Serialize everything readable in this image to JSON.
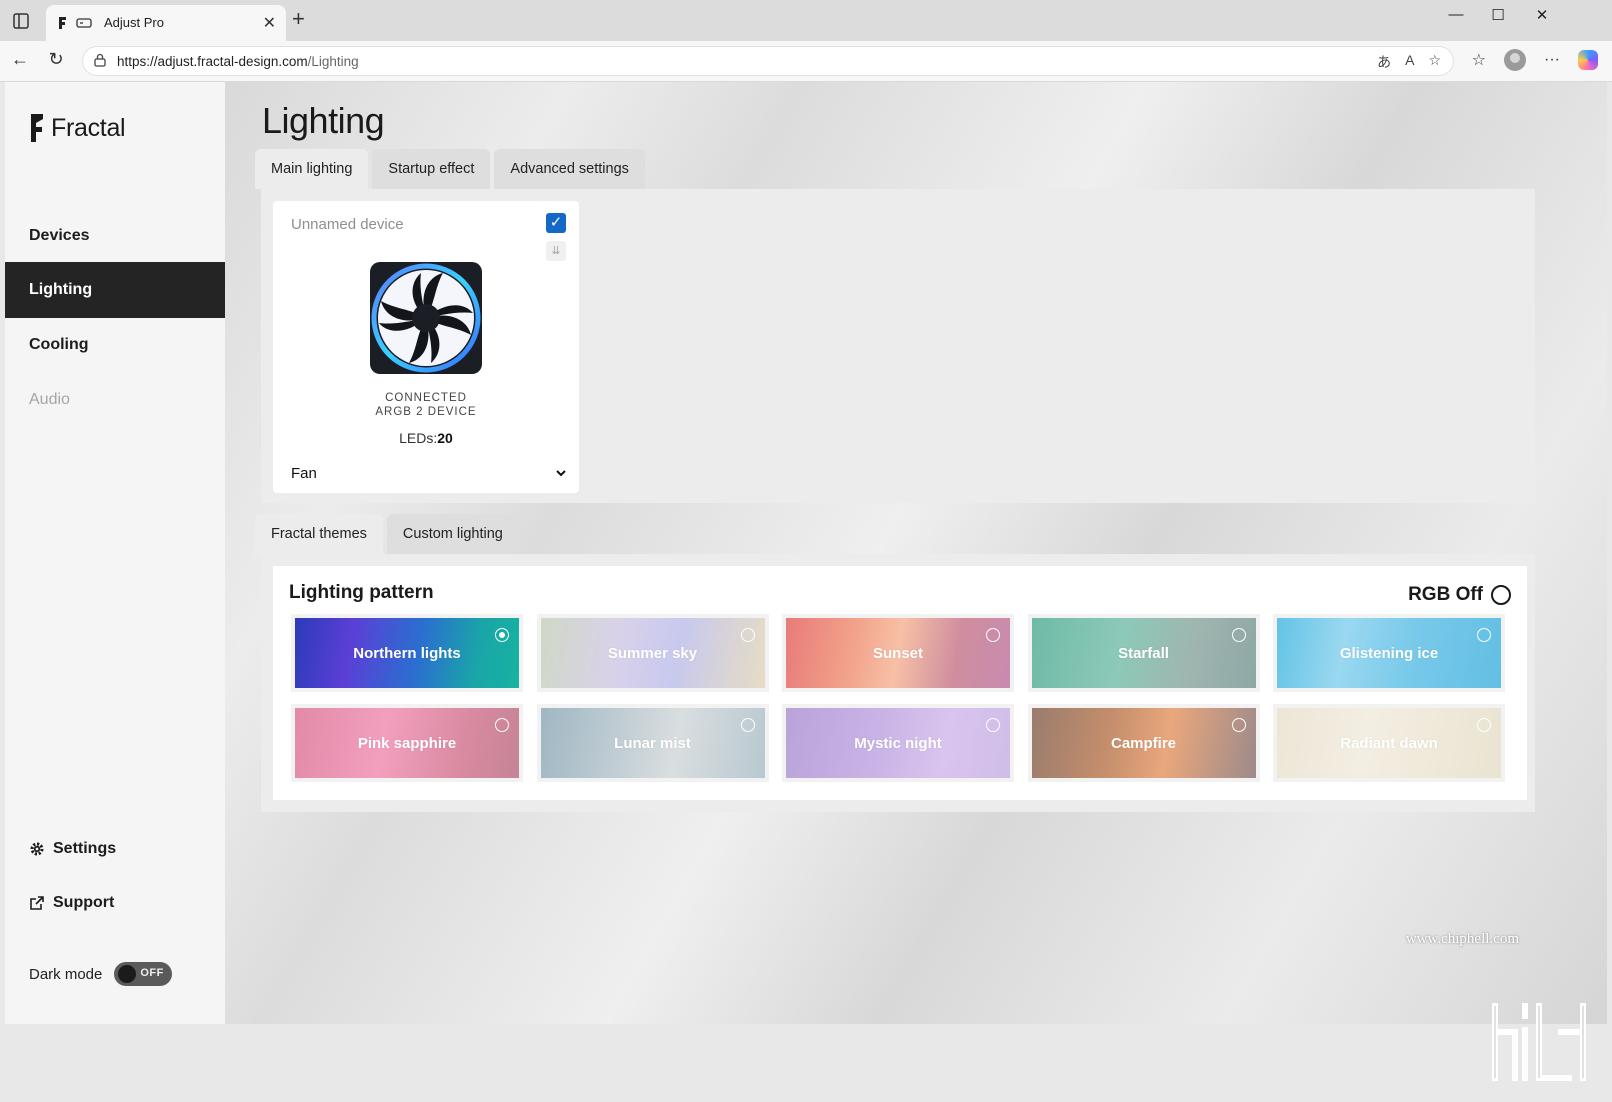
{
  "browser": {
    "tab_title": "Adjust Pro",
    "url_host": "https://adjust.fractal-design.com",
    "url_path": "/Lighting"
  },
  "sidebar": {
    "logo": "Fractal",
    "items": [
      {
        "label": "Devices",
        "state": "normal"
      },
      {
        "label": "Lighting",
        "state": "active"
      },
      {
        "label": "Cooling",
        "state": "normal"
      },
      {
        "label": "Audio",
        "state": "disabled"
      }
    ],
    "settings_label": "Settings",
    "support_label": "Support",
    "darkmode_label": "Dark mode",
    "darkmode_value": "OFF"
  },
  "main": {
    "title": "Lighting",
    "tabs": [
      {
        "label": "Main lighting",
        "active": true
      },
      {
        "label": "Startup effect",
        "active": false
      },
      {
        "label": "Advanced settings",
        "active": false
      }
    ],
    "device": {
      "name": "Unnamed device",
      "checked": true,
      "status_line1": "CONNECTED",
      "status_line2": "ARGB 2 DEVICE",
      "leds_label": "LEDs:",
      "leds_value": "20",
      "type": "Fan"
    },
    "lighting_tabs": [
      {
        "label": "Fractal themes",
        "active": true
      },
      {
        "label": "Custom lighting",
        "active": false
      }
    ],
    "pattern_title": "Lighting pattern",
    "rgb_off_label": "RGB Off",
    "themes": [
      {
        "label": "Northern lights",
        "selected": true
      },
      {
        "label": "Summer sky",
        "selected": false
      },
      {
        "label": "Sunset",
        "selected": false
      },
      {
        "label": "Starfall",
        "selected": false
      },
      {
        "label": "Glistening ice",
        "selected": false
      },
      {
        "label": "Pink sapphire",
        "selected": false
      },
      {
        "label": "Lunar mist",
        "selected": false
      },
      {
        "label": "Mystic night",
        "selected": false
      },
      {
        "label": "Campfire",
        "selected": false
      },
      {
        "label": "Radiant dawn",
        "selected": false
      }
    ]
  },
  "watermark": "www.chiphell.com",
  "colors": {
    "active_nav_bg": "#242424",
    "checkbox_blue": "#1668c7"
  }
}
